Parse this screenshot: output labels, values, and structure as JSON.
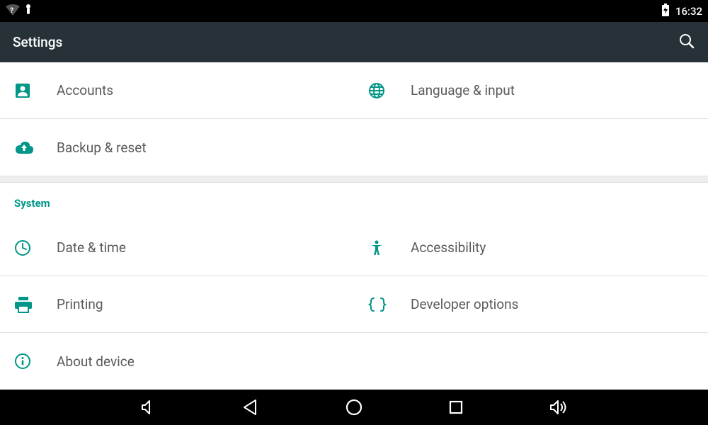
{
  "status": {
    "time": "16:32"
  },
  "appbar": {
    "title": "Settings"
  },
  "personal": {
    "accounts": "Accounts",
    "language": "Language & input",
    "backup": "Backup & reset"
  },
  "system": {
    "header": "System",
    "datetime": "Date & time",
    "accessibility": "Accessibility",
    "printing": "Printing",
    "developer": "Developer options",
    "about": "About device"
  },
  "colors": {
    "accent": "#009688",
    "appbar": "#263238"
  }
}
